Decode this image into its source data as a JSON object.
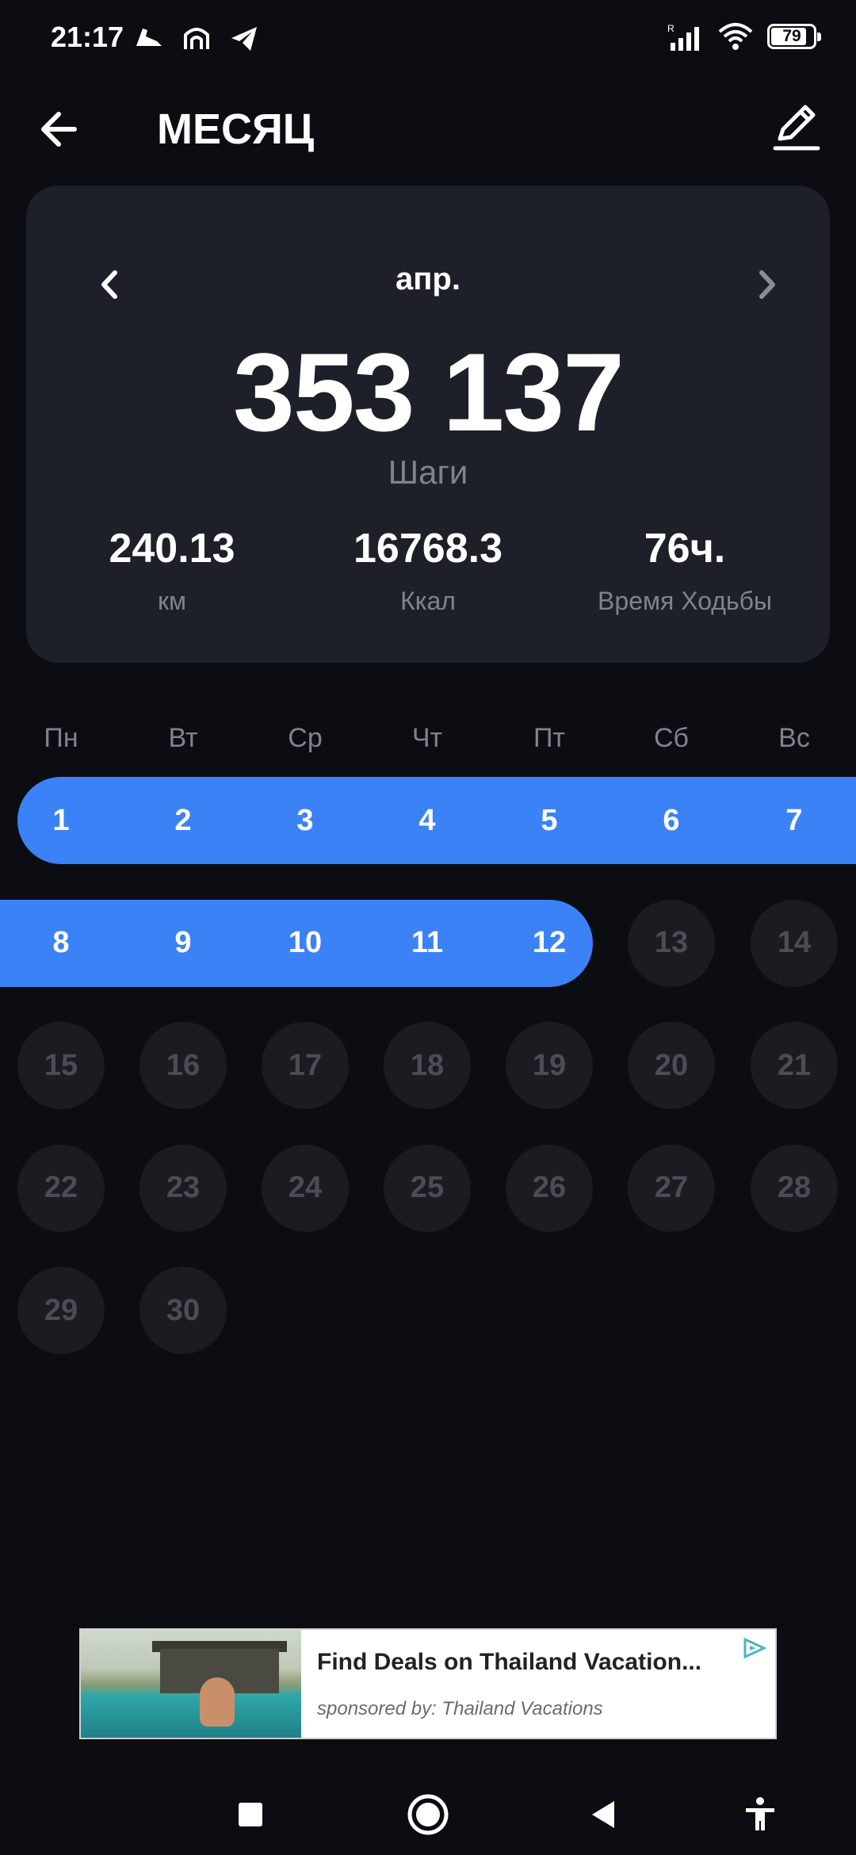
{
  "status": {
    "time": "21:17",
    "battery": "79"
  },
  "header": {
    "title": "МЕСЯЦ"
  },
  "summary": {
    "month": "апр.",
    "steps": "353 137",
    "steps_label": "Шаги",
    "stats": [
      {
        "value": "240.13",
        "label": "км"
      },
      {
        "value": "16768.3",
        "label": "Ккал"
      },
      {
        "value": "76ч.",
        "label": "Время Ходьбы"
      }
    ]
  },
  "calendar": {
    "weekdays": [
      "Пн",
      "Вт",
      "Ср",
      "Чт",
      "Пт",
      "Сб",
      "Вс"
    ],
    "days": [
      "1",
      "2",
      "3",
      "4",
      "5",
      "6",
      "7",
      "8",
      "9",
      "10",
      "11",
      "12",
      "13",
      "14",
      "15",
      "16",
      "17",
      "18",
      "19",
      "20",
      "21",
      "22",
      "23",
      "24",
      "25",
      "26",
      "27",
      "28",
      "29",
      "30"
    ],
    "first_weekday_index": 0,
    "active_through_day": 12,
    "accent": "#3b82f6"
  },
  "ad": {
    "title": "Find Deals on Thailand Vacation...",
    "sponsor": "sponsored by: Thailand Vacations"
  },
  "nav": {
    "icons": [
      "recents-square-icon",
      "home-circle-icon",
      "back-triangle-icon",
      "accessibility-icon"
    ]
  }
}
